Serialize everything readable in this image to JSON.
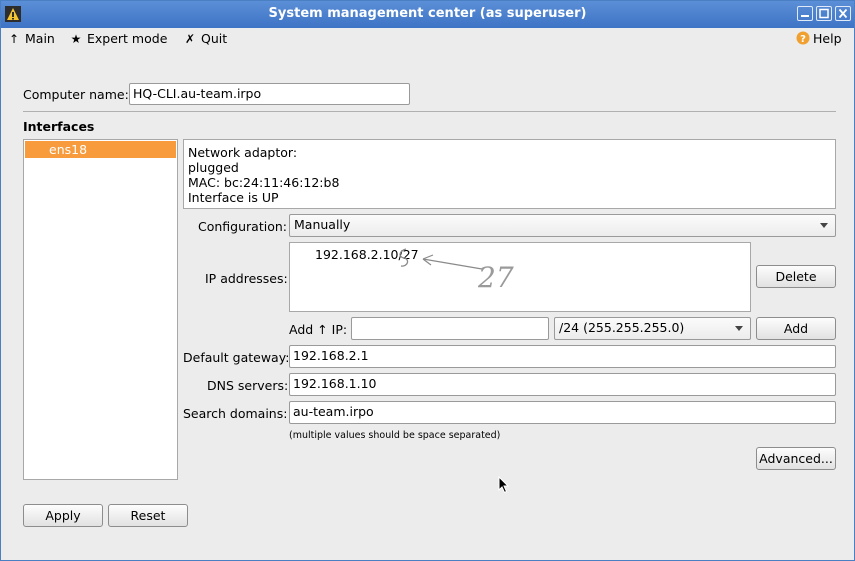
{
  "window": {
    "title": "System management center (as superuser)"
  },
  "menu": {
    "main": "Main",
    "expert_mode": "Expert mode",
    "quit": "Quit",
    "help": "Help"
  },
  "computer": {
    "label": "Computer name:",
    "value": "HQ-CLI.au-team.irpo"
  },
  "interfaces": {
    "heading": "Interfaces",
    "items": [
      {
        "name": "ens18",
        "selected": true
      }
    ],
    "info": [
      "Network adaptor:",
      "plugged",
      "MAC: bc:24:11:46:12:b8",
      "Interface is UP"
    ]
  },
  "configuration": {
    "label": "Configuration:",
    "value": "Manually"
  },
  "ip": {
    "label": "IP addresses:",
    "entries": [
      "192.168.2.10/27"
    ],
    "annotation": "27",
    "delete_label": "Delete",
    "add_label_prefix": "Add",
    "add_label_suffix": "IP:",
    "add_value": "",
    "mask_value": "/24 (255.255.255.0)",
    "add_button": "Add"
  },
  "gateway": {
    "label": "Default gateway:",
    "value": "192.168.2.1"
  },
  "dns": {
    "label": "DNS servers:",
    "value": "192.168.1.10"
  },
  "search": {
    "label": "Search domains:",
    "value": "au-team.irpo",
    "hint": "(multiple values should be space separated)"
  },
  "buttons": {
    "advanced": "Advanced...",
    "apply": "Apply",
    "reset": "Reset"
  },
  "colors": {
    "titlebar": "#3e74c6",
    "selection": "#f79b3d",
    "help_icon": "#f0a030"
  }
}
